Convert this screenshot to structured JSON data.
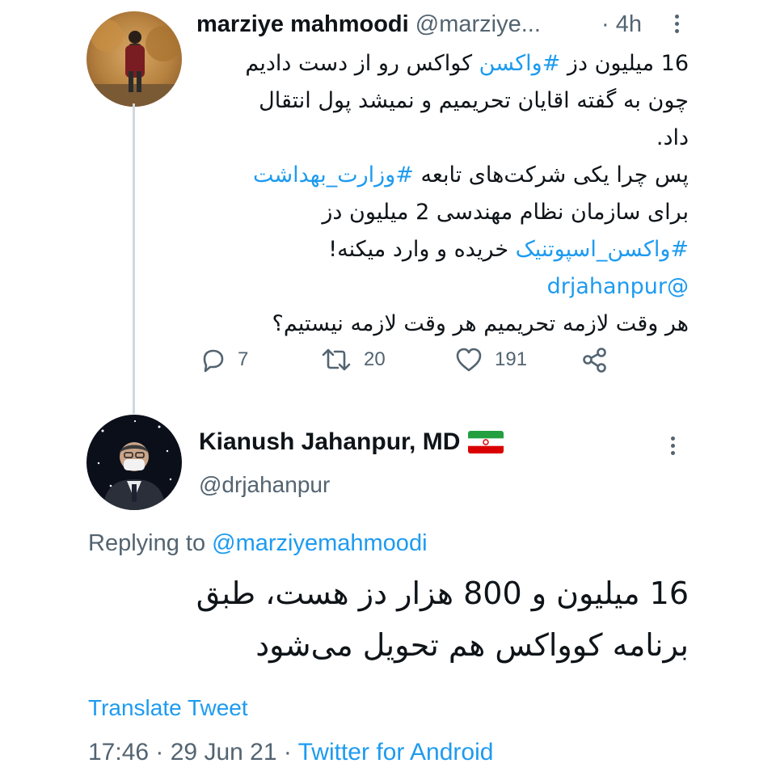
{
  "tweet1": {
    "author_name": "marziye mahmoodi",
    "author_handle": "@marziye...",
    "time_sep": "·",
    "time": "4h",
    "lines": [
      [
        {
          "t": "16 میلیون دز "
        },
        {
          "t": "#واکسن",
          "link": true
        },
        {
          "t": " کواکس رو از دست دادیم"
        }
      ],
      [
        {
          "t": "چون به گفته اقایان تحریمیم و نمیشد پول انتقال"
        }
      ],
      [
        {
          "t": "داد."
        }
      ],
      [
        {
          "t": "پس چرا یکی شرکت‌های تابعه "
        },
        {
          "t": "#وزارت_بهداشت",
          "link": true
        }
      ],
      [
        {
          "t": "برای سازمان نظام مهندسی 2 میلیون دز"
        }
      ],
      [
        {
          "t": "#واکسن_اسپوتنیک",
          "link": true
        },
        {
          "t": " خریده و وارد میکنه!"
        }
      ],
      [
        {
          "t": "@drjahanpur",
          "link": true
        }
      ],
      [
        {
          "t": "هر وقت لازمه تحریمیم هر وقت لازمه نیستیم؟"
        }
      ]
    ],
    "actions": {
      "reply_count": "7",
      "retweet_count": "20",
      "like_count": "191"
    }
  },
  "tweet2": {
    "author_name": "Kianush Jahanpur, MD",
    "author_handle": "@drjahanpur",
    "replying_label": "Replying to",
    "replying_handle": "@marziyemahmoodi",
    "lines": [
      "16 میلیون و 800 هزار دز هست، طبق",
      "برنامه کوواکس هم تحویل می‌شود"
    ],
    "translate_label": "Translate Tweet",
    "timestamp": "17:46 · 29 Jun 21 ·",
    "source": "Twitter for Android"
  },
  "colors": {
    "link": "#1d9bf0",
    "secondary": "#536471",
    "text": "#0f1419",
    "thread_line": "#cfd9de"
  },
  "icons": [
    "reply-icon",
    "retweet-icon",
    "like-icon",
    "share-icon",
    "more-icon",
    "iran-flag-icon"
  ]
}
